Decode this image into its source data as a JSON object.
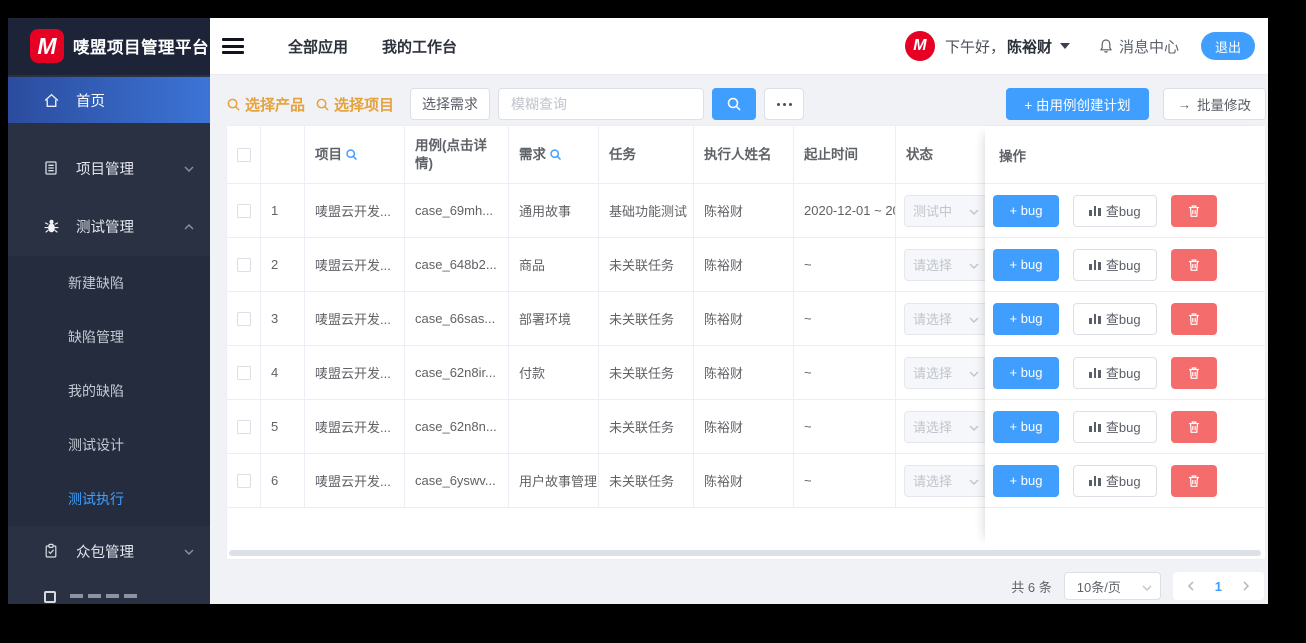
{
  "app": {
    "brand": "唛盟项目管理平台",
    "brand_letter": "M"
  },
  "header": {
    "nav_all_apps": "全部应用",
    "nav_workbench": "我的工作台",
    "greeting_prefix": "下午好，",
    "username": "陈裕财",
    "message_center": "消息中心",
    "logout": "退出",
    "avatar_letter": "M"
  },
  "sidebar": {
    "home": "首页",
    "project_mgmt": "项目管理",
    "test_mgmt": "测试管理",
    "test_children": [
      "新建缺陷",
      "缺陷管理",
      "我的缺陷",
      "测试设计",
      "测试执行"
    ],
    "crowd_mgmt": "众包管理"
  },
  "toolbar": {
    "select_product": "选择产品",
    "select_project": "选择项目",
    "select_requirement": "选择需求",
    "fuzzy_search_placeholder": "模糊查询",
    "create_plan_from_case": "+ 由用例创建计划",
    "batch_edit": "批量修改"
  },
  "icons": {
    "arrow_right": "→"
  },
  "table": {
    "columns": {
      "project": "项目",
      "usecase": "用例(点击详情)",
      "requirement": "需求",
      "task": "任务",
      "executor": "执行人姓名",
      "dates": "起止时间",
      "status": "状态",
      "actions": "操作"
    },
    "rows": [
      {
        "index": "1",
        "project": "唛盟云开发...",
        "usecase": "case_69mh...",
        "requirement": "通用故事",
        "task": "基础功能测试",
        "executor": "陈裕财",
        "dates": "2020-12-01 ~ 20",
        "status": "测试中"
      },
      {
        "index": "2",
        "project": "唛盟云开发...",
        "usecase": "case_648b2...",
        "requirement": "商品",
        "task": "未关联任务",
        "executor": "陈裕财",
        "dates": "~",
        "status": "请选择"
      },
      {
        "index": "3",
        "project": "唛盟云开发...",
        "usecase": "case_66sas...",
        "requirement": "部署环境",
        "task": "未关联任务",
        "executor": "陈裕财",
        "dates": "~",
        "status": "请选择"
      },
      {
        "index": "4",
        "project": "唛盟云开发...",
        "usecase": "case_62n8ir...",
        "requirement": "付款",
        "task": "未关联任务",
        "executor": "陈裕财",
        "dates": "~",
        "status": "请选择"
      },
      {
        "index": "5",
        "project": "唛盟云开发...",
        "usecase": "case_62n8n...",
        "requirement": "",
        "task": "未关联任务",
        "executor": "陈裕财",
        "dates": "~",
        "status": "请选择"
      },
      {
        "index": "6",
        "project": "唛盟云开发...",
        "usecase": "case_6yswv...",
        "requirement": "用户故事管理",
        "task": "未关联任务",
        "executor": "陈裕财",
        "dates": "~",
        "status": "请选择"
      }
    ]
  },
  "row_actions": {
    "add_bug": "+ bug",
    "view_bug": "查bug"
  },
  "pagination": {
    "total": "共 6 条",
    "page_size": "10条/页",
    "page": "1"
  },
  "colors": {
    "accent_blue": "#409eff",
    "danger_red": "#f56c6c",
    "brand_red": "#e60023",
    "warning_orange": "#e6a23c"
  }
}
